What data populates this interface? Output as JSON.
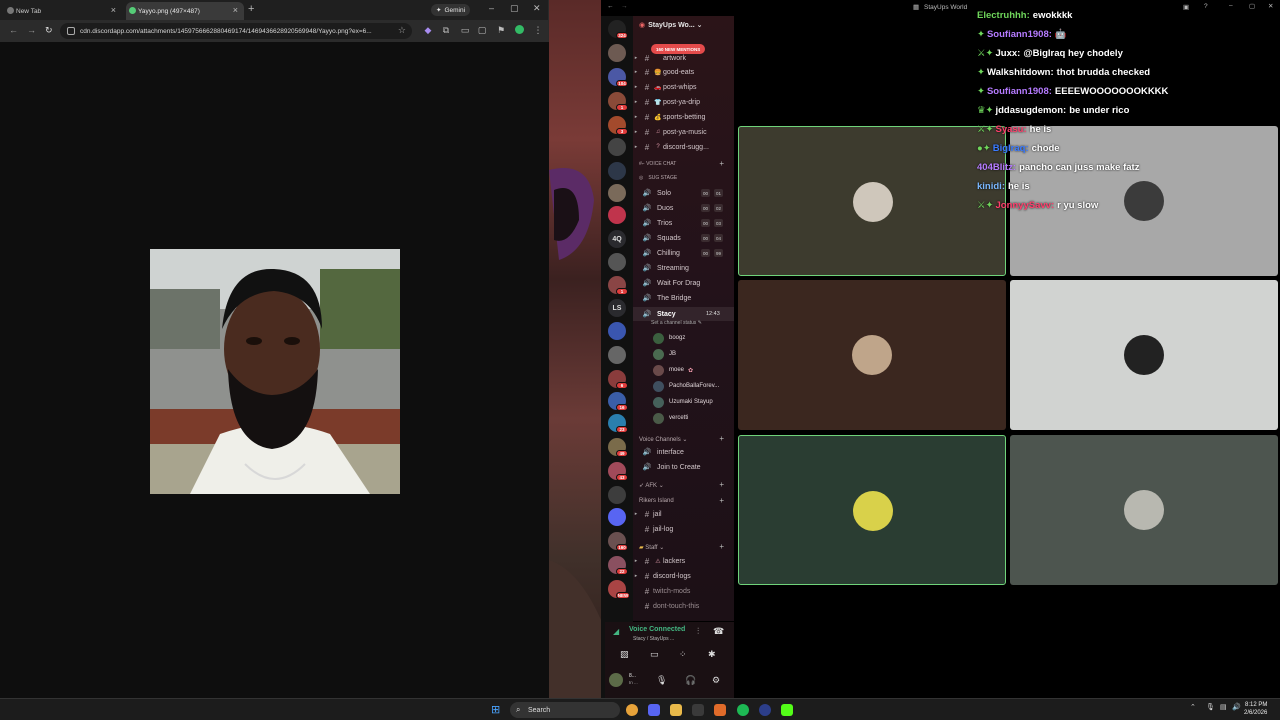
{
  "browser": {
    "tabs": [
      {
        "label": "New Tab",
        "active": false
      },
      {
        "label": "Yayyo.png (497×487)",
        "active": true
      }
    ],
    "gemini_label": "Gemini",
    "url": "cdn.discordapp.com/attachments/1459756662880469174/1469436628920569948/Yayyo.png?ex=6..."
  },
  "discord": {
    "title": "StayUps World",
    "server_name": "StayUps Wo...",
    "mentions_banner": "160 NEW MENTIONS",
    "server_badges": [
      "324",
      "104",
      "1",
      "3",
      "1",
      "6",
      "16",
      "23",
      "49",
      "43",
      "160",
      "22"
    ],
    "server_labels": [
      "4Q",
      "LS",
      "NEW"
    ],
    "channels_text": [
      {
        "name": "artwork",
        "emoji": ""
      },
      {
        "name": "good-eats",
        "emoji": "🍔"
      },
      {
        "name": "post-whips",
        "emoji": "🚗"
      },
      {
        "name": "post-ya-drip",
        "emoji": "👕"
      },
      {
        "name": "sports-betting",
        "emoji": "💰"
      },
      {
        "name": "post-ya-music",
        "emoji": "♫"
      },
      {
        "name": "discord-sugg...",
        "emoji": "?"
      }
    ],
    "category_voice": "VOICE CHAT",
    "stage_label": "SUG STAGE",
    "voice_channels": [
      {
        "name": "Solo",
        "a": "00",
        "b": "01"
      },
      {
        "name": "Duos",
        "a": "00",
        "b": "02"
      },
      {
        "name": "Trios",
        "a": "00",
        "b": "03"
      },
      {
        "name": "Squads",
        "a": "00",
        "b": "04"
      },
      {
        "name": "Chilling",
        "a": "00",
        "b": "99"
      },
      {
        "name": "Streaming"
      },
      {
        "name": "Wait For Drag"
      },
      {
        "name": "The Bridge"
      }
    ],
    "active_channel": {
      "name": "Stacy",
      "timer": "12:43",
      "status": "Set a channel status"
    },
    "voice_users": [
      "boogz",
      "JB",
      "moee",
      "PachoBallaForev...",
      "Uzumaki Stayup",
      "vercetti"
    ],
    "category_voice_channels": "Voice Channels",
    "voice_extra": [
      "interface",
      "Join to Create"
    ],
    "category_afk": "AFK",
    "category_rikers": "Rikers Island",
    "rikers_channels": [
      "jail",
      "jail-log"
    ],
    "category_staff": "Staff",
    "staff_channels": [
      {
        "name": "lackers",
        "emoji": "⚠"
      },
      {
        "name": "discord-logs"
      },
      {
        "name": "twitch-mods"
      },
      {
        "name": "dont-touch-this"
      }
    ],
    "voice_connected": "Voice Connected",
    "voice_location": "Stacy / StayUps ...",
    "user_short": "8...",
    "user_status": "In ..."
  },
  "chat": [
    {
      "name": "Electruhhh",
      "text": "ewokkkk",
      "color": "#6fd65b",
      "badge": ""
    },
    {
      "name": "Soufiann1908",
      "text": "🤖",
      "color": "#b57bff",
      "badge": "gem"
    },
    {
      "name": "Juxx",
      "text": "@BigIraq hey chodely",
      "color": "#ffffff",
      "badge": "sword-gem"
    },
    {
      "name": "Walkshitdown",
      "text": "thot brudda checked",
      "color": "#ffffff",
      "badge": "gem"
    },
    {
      "name": "Soufiann1908",
      "text": "EEEEWOOOOOOOKKKK",
      "color": "#b57bff",
      "badge": "gem"
    },
    {
      "name": "jddasugdemon",
      "text": "be under rico",
      "color": "#ffffff",
      "badge": "crown-gem"
    },
    {
      "name": "Syasu",
      "text": "he is",
      "color": "#ff3e6c",
      "badge": "sword-bat"
    },
    {
      "name": "BigIraq",
      "text": "chode",
      "color": "#3a7bff",
      "badge": "coin-gem"
    },
    {
      "name": "404Blitz",
      "text": "pancho can juss make fatz",
      "color": "#b57bff",
      "badge": ""
    },
    {
      "name": "kinidi",
      "text": "he is",
      "color": "#7ab8ff",
      "badge": ""
    },
    {
      "name": "JonnyySavv",
      "text": "r yu slow",
      "color": "#ff3e6c",
      "badge": "sword-bat"
    }
  ],
  "taskbar": {
    "search_label": "Search",
    "time": "8:12 PM",
    "date": "2/6/2026"
  },
  "colors": {
    "discord_green": "#43b581",
    "mention_red": "#e44b4b",
    "tile_border_active": "#3b7a4a"
  }
}
